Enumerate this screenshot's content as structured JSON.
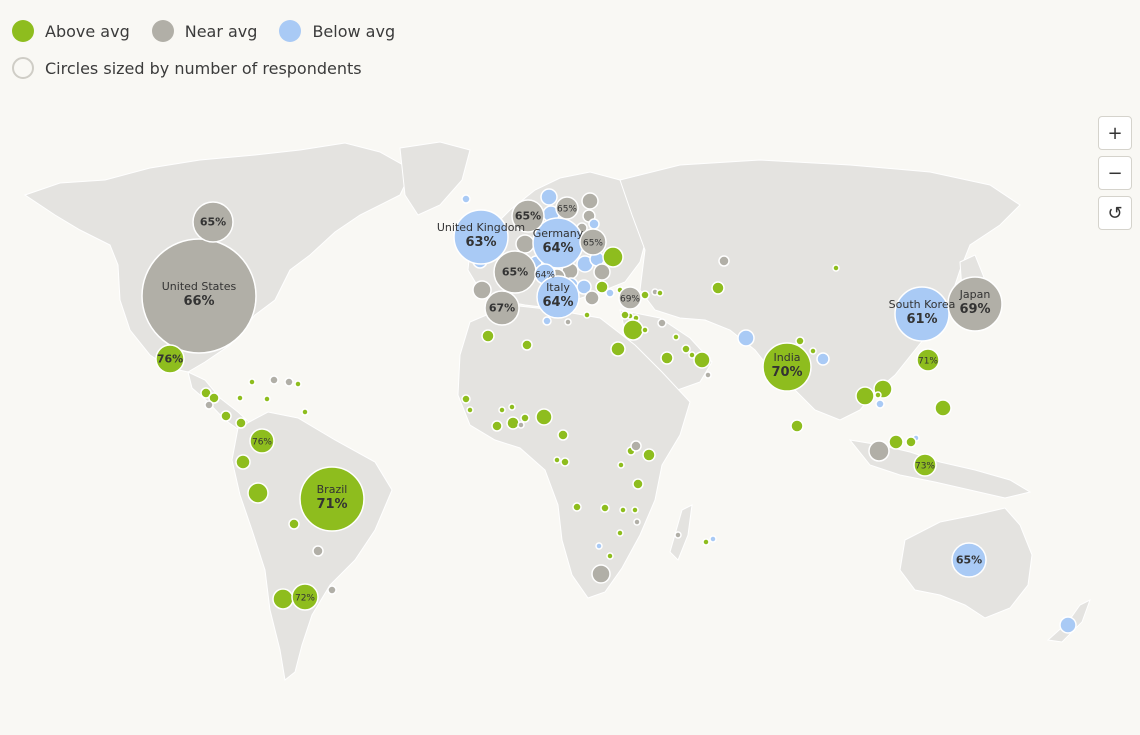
{
  "legend": {
    "items": [
      {
        "label": "Above avg",
        "color": "#8ebd1e"
      },
      {
        "label": "Near avg",
        "color": "#b1afa7"
      },
      {
        "label": "Below avg",
        "color": "#a9caf5"
      }
    ],
    "size_note": "Circles sized by number of respondents"
  },
  "zoom": {
    "in": "+",
    "out": "−",
    "reset": "↺"
  },
  "colors": {
    "above": "#8ebd1e",
    "near": "#b1afa7",
    "below": "#a9caf5",
    "land": "#e4e3e0",
    "background": "#f9f8f4"
  },
  "labeled_bubbles": [
    {
      "name": "United States",
      "value": "66%",
      "category": "near"
    },
    {
      "name": "",
      "value": "65%",
      "category": "near"
    },
    {
      "name": "",
      "value": "76%",
      "category": "above"
    },
    {
      "name": "",
      "value": "76%",
      "category": "above"
    },
    {
      "name": "Brazil",
      "value": "71%",
      "category": "above"
    },
    {
      "name": "",
      "value": "72%",
      "category": "above"
    },
    {
      "name": "United Kingdom",
      "value": "63%",
      "category": "below"
    },
    {
      "name": "Germany",
      "value": "64%",
      "category": "below"
    },
    {
      "name": "",
      "value": "65%",
      "category": "near"
    },
    {
      "name": "",
      "value": "65%",
      "category": "near"
    },
    {
      "name": "",
      "value": "65%",
      "category": "near"
    },
    {
      "name": "",
      "value": "65%",
      "category": "near"
    },
    {
      "name": "",
      "value": "64%",
      "category": "below"
    },
    {
      "name": "Italy",
      "value": "64%",
      "category": "below"
    },
    {
      "name": "",
      "value": "67%",
      "category": "near"
    },
    {
      "name": "",
      "value": "69%",
      "category": "near"
    },
    {
      "name": "India",
      "value": "70%",
      "category": "above"
    },
    {
      "name": "South Korea",
      "value": "61%",
      "category": "below"
    },
    {
      "name": "Japan",
      "value": "69%",
      "category": "near"
    },
    {
      "name": "",
      "value": "71%",
      "category": "above"
    },
    {
      "name": "",
      "value": "73%",
      "category": "above"
    },
    {
      "name": "",
      "value": "65%",
      "category": "below"
    }
  ]
}
